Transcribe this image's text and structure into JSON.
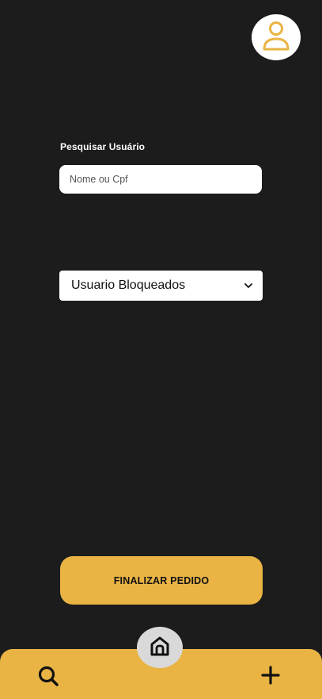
{
  "header": {
    "avatar_icon": "user-icon",
    "accent_color": "#e9b444"
  },
  "search": {
    "label": "Pesquisar Usuário",
    "placeholder": "Nome ou Cpf",
    "value": ""
  },
  "filter": {
    "selected": "Usuario Bloqueados",
    "icon": "chevron-down-icon"
  },
  "actions": {
    "finalize_label": "FINALIZAR PEDIDO"
  },
  "bottom_nav": {
    "items": [
      {
        "icon": "search-icon"
      },
      {
        "icon": "home-icon"
      },
      {
        "icon": "plus-icon"
      }
    ],
    "background": "#e9b444",
    "home_background": "#d9d9d9"
  },
  "colors": {
    "page_background": "#1c1c1c",
    "accent": "#e9b444"
  }
}
